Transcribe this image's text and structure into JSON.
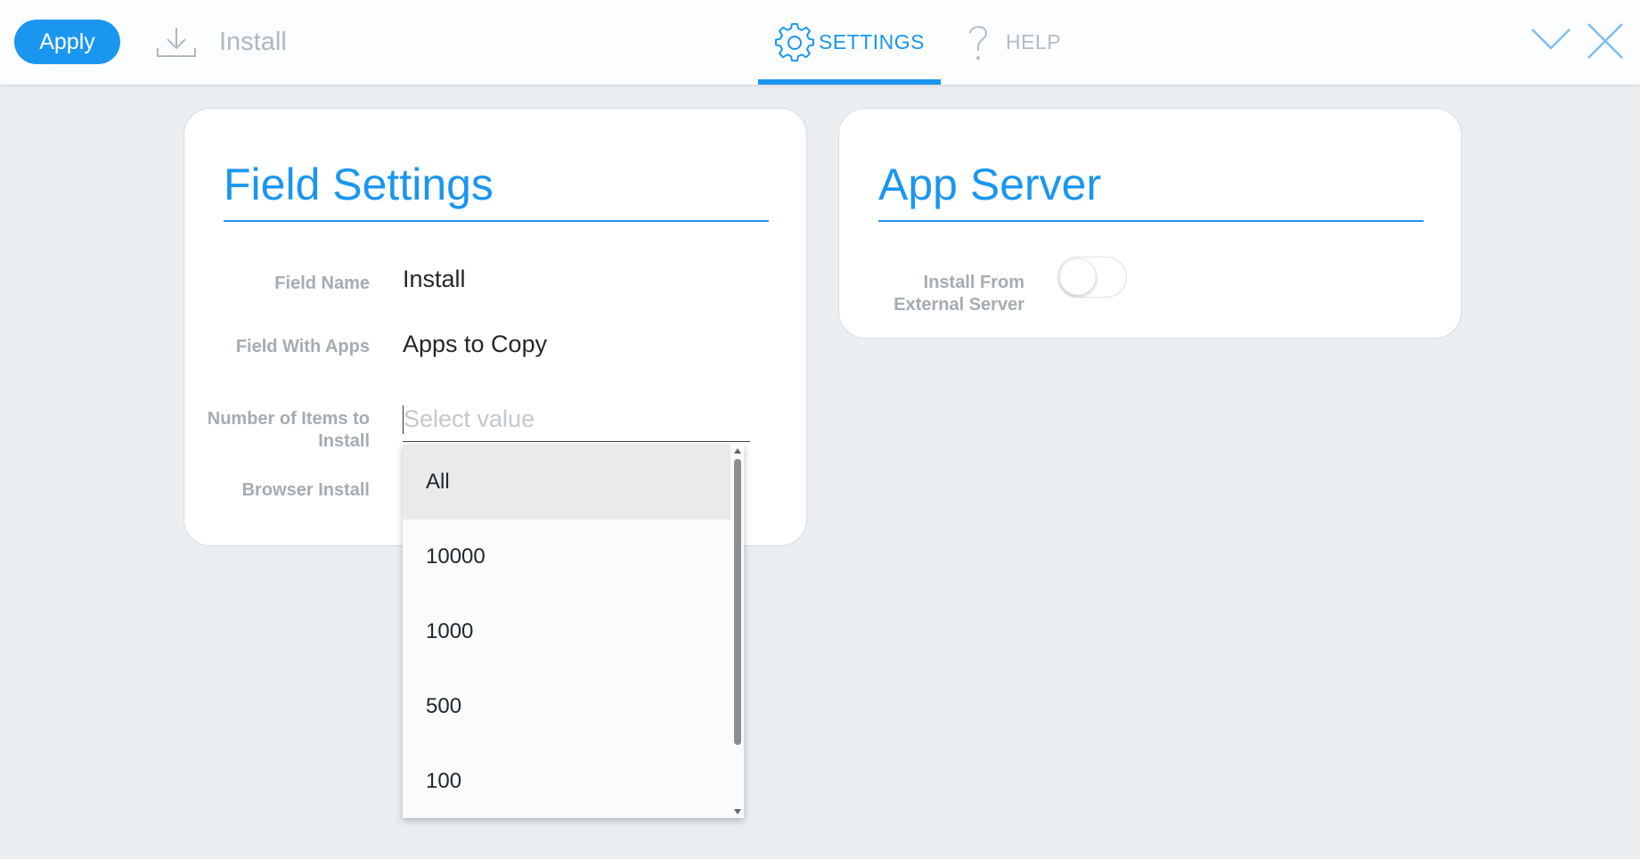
{
  "toolbar": {
    "apply_label": "Apply",
    "install_label": "Install"
  },
  "tabs": {
    "settings_label": "SETTINGS",
    "help_label": "HELP"
  },
  "field_settings": {
    "title": "Field Settings",
    "field_name_label": "Field Name",
    "field_name_value": "Install",
    "field_with_apps_label": "Field With Apps",
    "field_with_apps_value": "Apps to Copy",
    "number_of_items_label": "Number of Items to Install",
    "number_of_items_placeholder": "Select value",
    "browser_install_label": "Browser Install"
  },
  "dropdown": {
    "options": [
      "All",
      "10000",
      "1000",
      "500",
      "100"
    ],
    "highlighted": "All"
  },
  "app_server": {
    "title": "App Server",
    "install_external_label": "Install From External Server",
    "install_external_enabled": false
  },
  "colors": {
    "accent": "#1b96f0",
    "background": "#ebeff2"
  }
}
